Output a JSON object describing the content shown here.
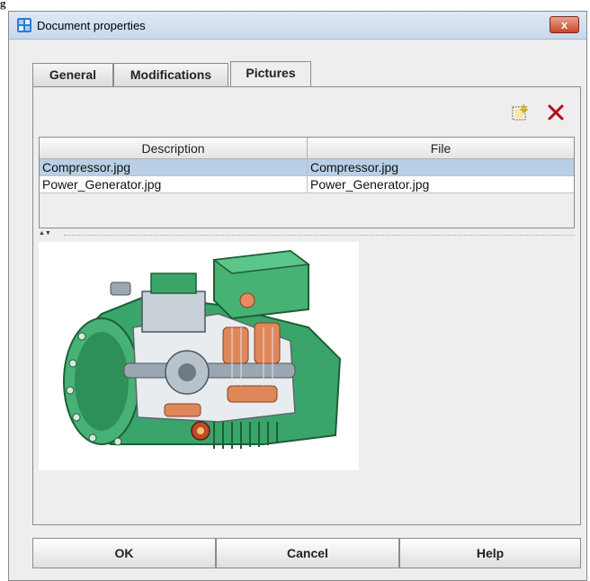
{
  "window": {
    "title": "Document properties",
    "close_symbol": "x"
  },
  "tabs": [
    {
      "label": "General",
      "active": false
    },
    {
      "label": "Modifications",
      "active": false
    },
    {
      "label": "Pictures",
      "active": true
    }
  ],
  "toolbar": {
    "new_icon": "new-picture-icon",
    "delete_icon": "delete-icon"
  },
  "table": {
    "columns": [
      "Description",
      "File"
    ],
    "rows": [
      {
        "description": "Compressor.jpg",
        "file": "Compressor.jpg",
        "selected": true
      },
      {
        "description": "Power_Generator.jpg",
        "file": "Power_Generator.jpg",
        "selected": false
      }
    ]
  },
  "preview": {
    "image": "compressor-cutaway-illustration",
    "accent": "#2f9a5a"
  },
  "buttons": {
    "ok": "OK",
    "cancel": "Cancel",
    "help": "Help"
  },
  "colors": {
    "selection": "#b8cfe5",
    "titlebar": "#c8d8ec",
    "close": "#c8452a"
  }
}
